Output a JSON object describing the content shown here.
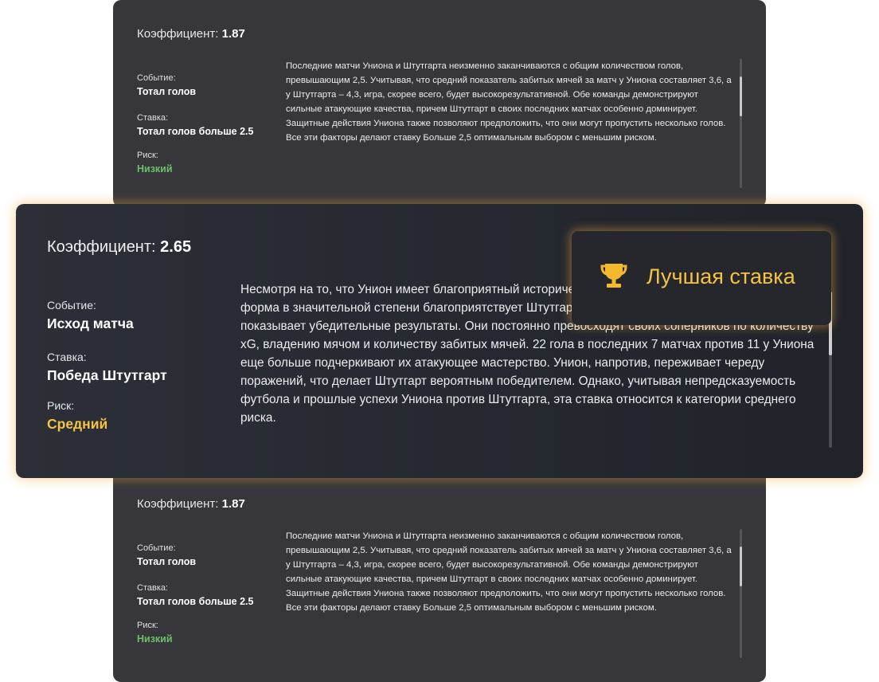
{
  "top_card": {
    "coef_label": "Коэффициент:",
    "coef_value": "1.87",
    "event_label": "Событие:",
    "event_value": "Тотал голов",
    "bet_label": "Ставка:",
    "bet_value": "Тотал голов больше 2.5",
    "risk_label": "Риск:",
    "risk_value": "Низкий",
    "description": "Последние матчи Униона и Штутгарта неизменно заканчиваются с общим количеством голов, превышающим 2,5. Учитывая, что средний показатель забитых мячей за матч у Униона составляет 3,6, а у Штутгарта – 4,3, игра, скорее всего, будет высокорезультативной. Обе команды демонстрируют сильные атакующие качества, причем Штутгарт в своих последних матчах особенно доминирует. Защитные действия Униона также позволяют предположить, что они могут пропустить несколько голов. Все эти факторы делают ставку Больше 2,5 оптимальным выбором с меньшим риском."
  },
  "main_card": {
    "coef_label": "Коэффициент:",
    "coef_value": "2.65",
    "event_label": "Событие:",
    "event_value": "Исход матча",
    "bet_label": "Ставка:",
    "bet_value": "Победа Штутгарт",
    "risk_label": "Риск:",
    "risk_value": "Средний",
    "description": "Несмотря на то, что Унион имеет благоприятный исторический рекорд против Штутгартом, текущая форма в значительной степени благоприятствует Штутгарту. В своих последних матчах Штутгарт показывает убедительные результаты. Они постоянно превосходят своих соперников по количеству xG, владению мячом и количеству забитых мячей. 22 гола в последних 7 матчах против 11 у Униона еще больше подчеркивают их атакующее мастерство. Унион, напротив, переживает череду поражений, что делает Штутгарт вероятным победителем. Однако, учитывая непредсказуемость футбола и прошлые успехи Униона против Штутгарта, эта ставка относится к категории среднего риска."
  },
  "badge": {
    "icon": "trophy-icon",
    "title": "Лучшая ставка"
  },
  "bottom_card": {
    "coef_label": "Коэффициент:",
    "coef_value": "1.87",
    "event_label": "Событие:",
    "event_value": "Тотал голов",
    "bet_label": "Ставка:",
    "bet_value": "Тотал голов больше 2.5",
    "risk_label": "Риск:",
    "risk_value": "Низкий",
    "description": "Последние матчи Униона и Штутгарта неизменно заканчиваются с общим количеством голов, превышающим 2,5. Учитывая, что средний показатель забитых мячей за матч у Униона составляет 3,6, а у Штутгарта – 4,3, игра, скорее всего, будет высокорезультативной. Обе команды демонстрируют сильные атакующие качества, причем Штутгарт в своих последних матчах особенно доминирует. Защитные действия Униона также позволяют предположить, что они могут пропустить несколько голов. Все эти факторы делают ставку Больше 2,5 оптимальным выбором с меньшим риском."
  },
  "colors": {
    "risk_low": "#6cc067",
    "risk_medium": "#f5c242",
    "accent_glow": "#f0aa3c"
  }
}
